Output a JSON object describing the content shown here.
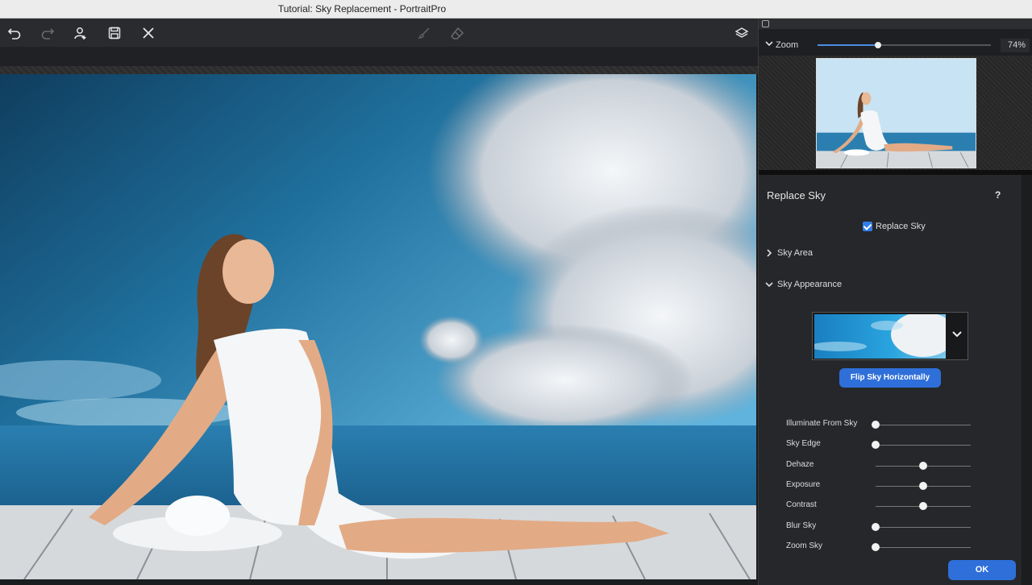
{
  "window": {
    "title": "Tutorial: Sky Replacement - PortraitPro"
  },
  "toolbar": {
    "icons": [
      "undo-icon",
      "redo-icon",
      "add-person-icon",
      "save-icon",
      "close-icon",
      "brush-icon",
      "eraser-icon",
      "layers-icon"
    ]
  },
  "navigator": {
    "zoom_label": "Zoom",
    "zoom_value": "74%",
    "zoom_level": 0.35
  },
  "panel": {
    "title": "Replace Sky",
    "help": "?",
    "replace_sky_checkbox": {
      "label": "Replace Sky",
      "checked": true
    },
    "sky_area": {
      "label": "Sky Area",
      "expanded": false
    },
    "sky_appearance": {
      "label": "Sky Appearance",
      "expanded": true
    },
    "flip_button": "Flip Sky Horizontally",
    "sliders": [
      {
        "label": "Illuminate From Sky",
        "value": 0
      },
      {
        "label": "Sky Edge",
        "value": 0
      },
      {
        "label": "Dehaze",
        "value": 0.5
      },
      {
        "label": "Exposure",
        "value": 0.5
      },
      {
        "label": "Contrast",
        "value": 0.5
      },
      {
        "label": "Blur Sky",
        "value": 0
      },
      {
        "label": "Zoom Sky",
        "value": 0
      }
    ],
    "ok_button": "OK"
  },
  "colors": {
    "accent": "#2f6fd9",
    "panel_bg": "#26272a",
    "toolbar_bg": "#2a2b2e"
  }
}
